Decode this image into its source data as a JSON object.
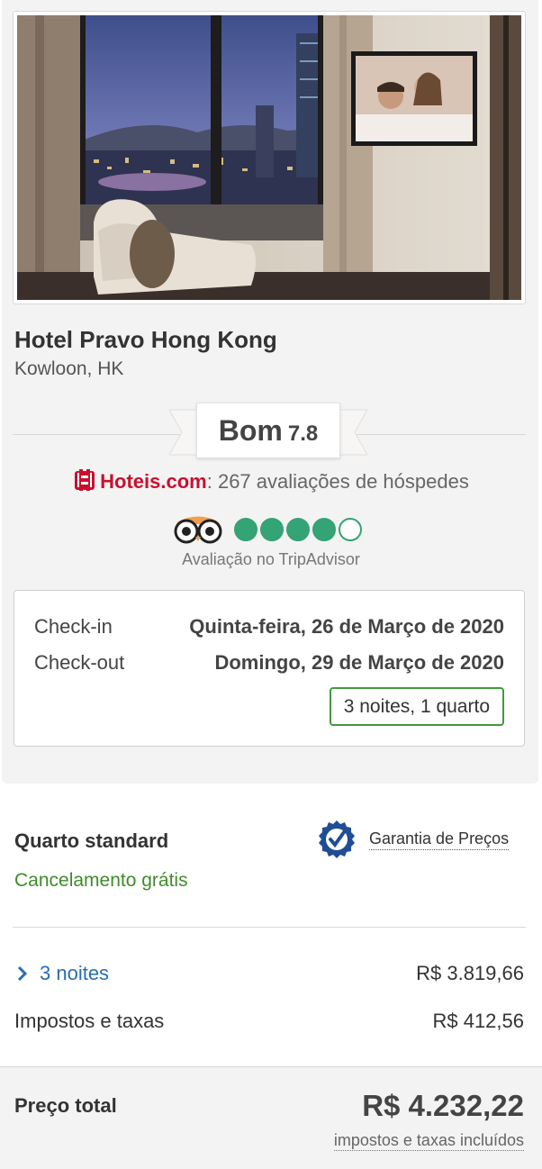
{
  "hotel": {
    "name": "Hotel Pravo Hong Kong",
    "location": "Kowloon, HK"
  },
  "rating": {
    "word": "Bom",
    "score": "7.8"
  },
  "reviews": {
    "brand": "Hoteis.com",
    "text": ": 267 avaliações de hóspedes",
    "brand_color": "#c8102e"
  },
  "tripadvisor": {
    "bubbles_filled": 4,
    "bubbles_total": 5,
    "label": "Avaliação no TripAdvisor",
    "color": "#34a375"
  },
  "stay": {
    "checkin_label": "Check-in",
    "checkin_value": "Quinta-feira, 26 de Março de 2020",
    "checkout_label": "Check-out",
    "checkout_value": "Domingo, 29 de Março de 2020",
    "summary": "3 noites, 1 quarto"
  },
  "room": {
    "type": "Quarto standard",
    "cancellation": "Cancelamento grátis",
    "guarantee": "Garantia de Preços"
  },
  "pricing": {
    "nights_label": "3 noites",
    "nights_price": "R$ 3.819,66",
    "taxes_label": "Impostos e taxas",
    "taxes_price": "R$ 412,56",
    "total_label": "Preço total",
    "total_price": "R$ 4.232,22",
    "total_note": "impostos e taxas incluídos"
  }
}
